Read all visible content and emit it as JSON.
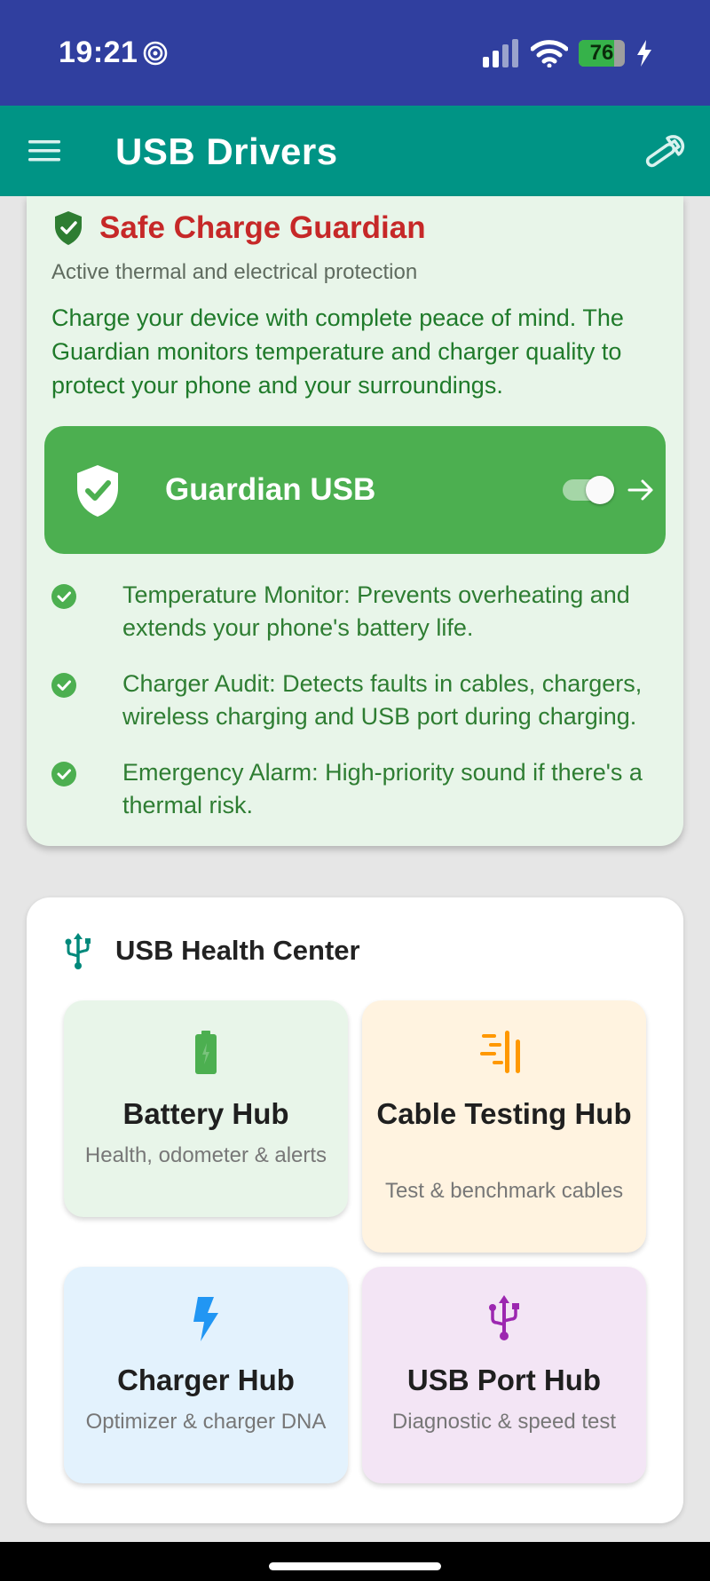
{
  "status_bar": {
    "time": "19:21",
    "battery_level": "76",
    "battery_fraction": 0.76
  },
  "app_bar": {
    "title": "USB Drivers"
  },
  "guardian": {
    "title": "Safe Charge Guardian",
    "subtitle": "Active thermal and electrical protection",
    "description": "Charge your device with complete peace of mind. The Guardian monitors temperature and charger quality to protect your phone and your surroundings.",
    "banner_label": "Guardian USB",
    "toggle_on": true,
    "features": [
      "Temperature Monitor: Prevents overheating and extends your phone's battery life.",
      "Charger Audit: Detects faults in cables, chargers, wireless charging and USB port during charging.",
      "Emergency Alarm: High-priority sound if there's a thermal risk."
    ]
  },
  "health_center": {
    "title": "USB Health Center",
    "tiles": [
      {
        "title": "Battery Hub",
        "subtitle": "Health, odometer & alerts",
        "icon": "battery-icon",
        "bg": "#e8f5e9",
        "icon_color": "#4caf50"
      },
      {
        "title": "Cable Testing Hub",
        "subtitle": "Test & benchmark cables",
        "icon": "cable-test-icon",
        "bg": "#fff3e0",
        "icon_color": "#ff9800"
      },
      {
        "title": "Charger Hub",
        "subtitle": "Optimizer & charger DNA",
        "icon": "lightning-icon",
        "bg": "#e3f2fd",
        "icon_color": "#2196f3"
      },
      {
        "title": "USB Port Hub",
        "subtitle": "Diagnostic & speed test",
        "icon": "usb-icon",
        "bg": "#f3e5f5",
        "icon_color": "#9c27b0"
      }
    ]
  },
  "colors": {
    "status_bar": "#303f9f",
    "app_bar": "#009485",
    "guardian_title": "#c62828",
    "guardian_banner": "#4caf50"
  }
}
